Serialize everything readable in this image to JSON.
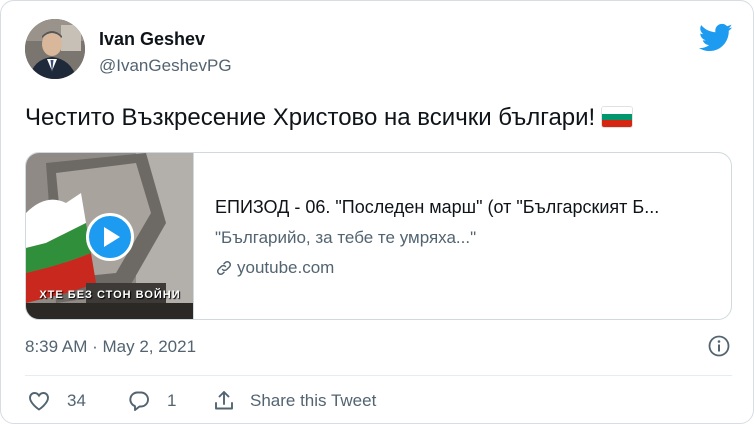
{
  "author": {
    "name": "Ivan Geshev",
    "handle": "@IvanGeshevPG"
  },
  "tweet": {
    "text": "Честито Възкресение Христово на всички българи!",
    "flag_colors": [
      "#ffffff",
      "#00966e",
      "#d62612"
    ]
  },
  "card": {
    "title": "ЕПИЗОД - 06. \"Последен марш\" (от \"Българският Б...",
    "description": "\"Българийо, за тебе те умряха...\"",
    "domain": "youtube.com",
    "video_caption": "ХТЕ БЕЗ СТОН ВОЙНИ"
  },
  "meta": {
    "timestamp": "8:39 AM · May 2, 2021"
  },
  "actions": {
    "likes": "34",
    "replies": "1",
    "share_label": "Share this Tweet"
  },
  "colors": {
    "brand": "#1d9bf0",
    "secondary_text": "#536471"
  },
  "icons": [
    "twitter-bird-icon",
    "play-icon",
    "link-icon",
    "info-icon",
    "heart-icon",
    "reply-icon",
    "share-icon"
  ]
}
